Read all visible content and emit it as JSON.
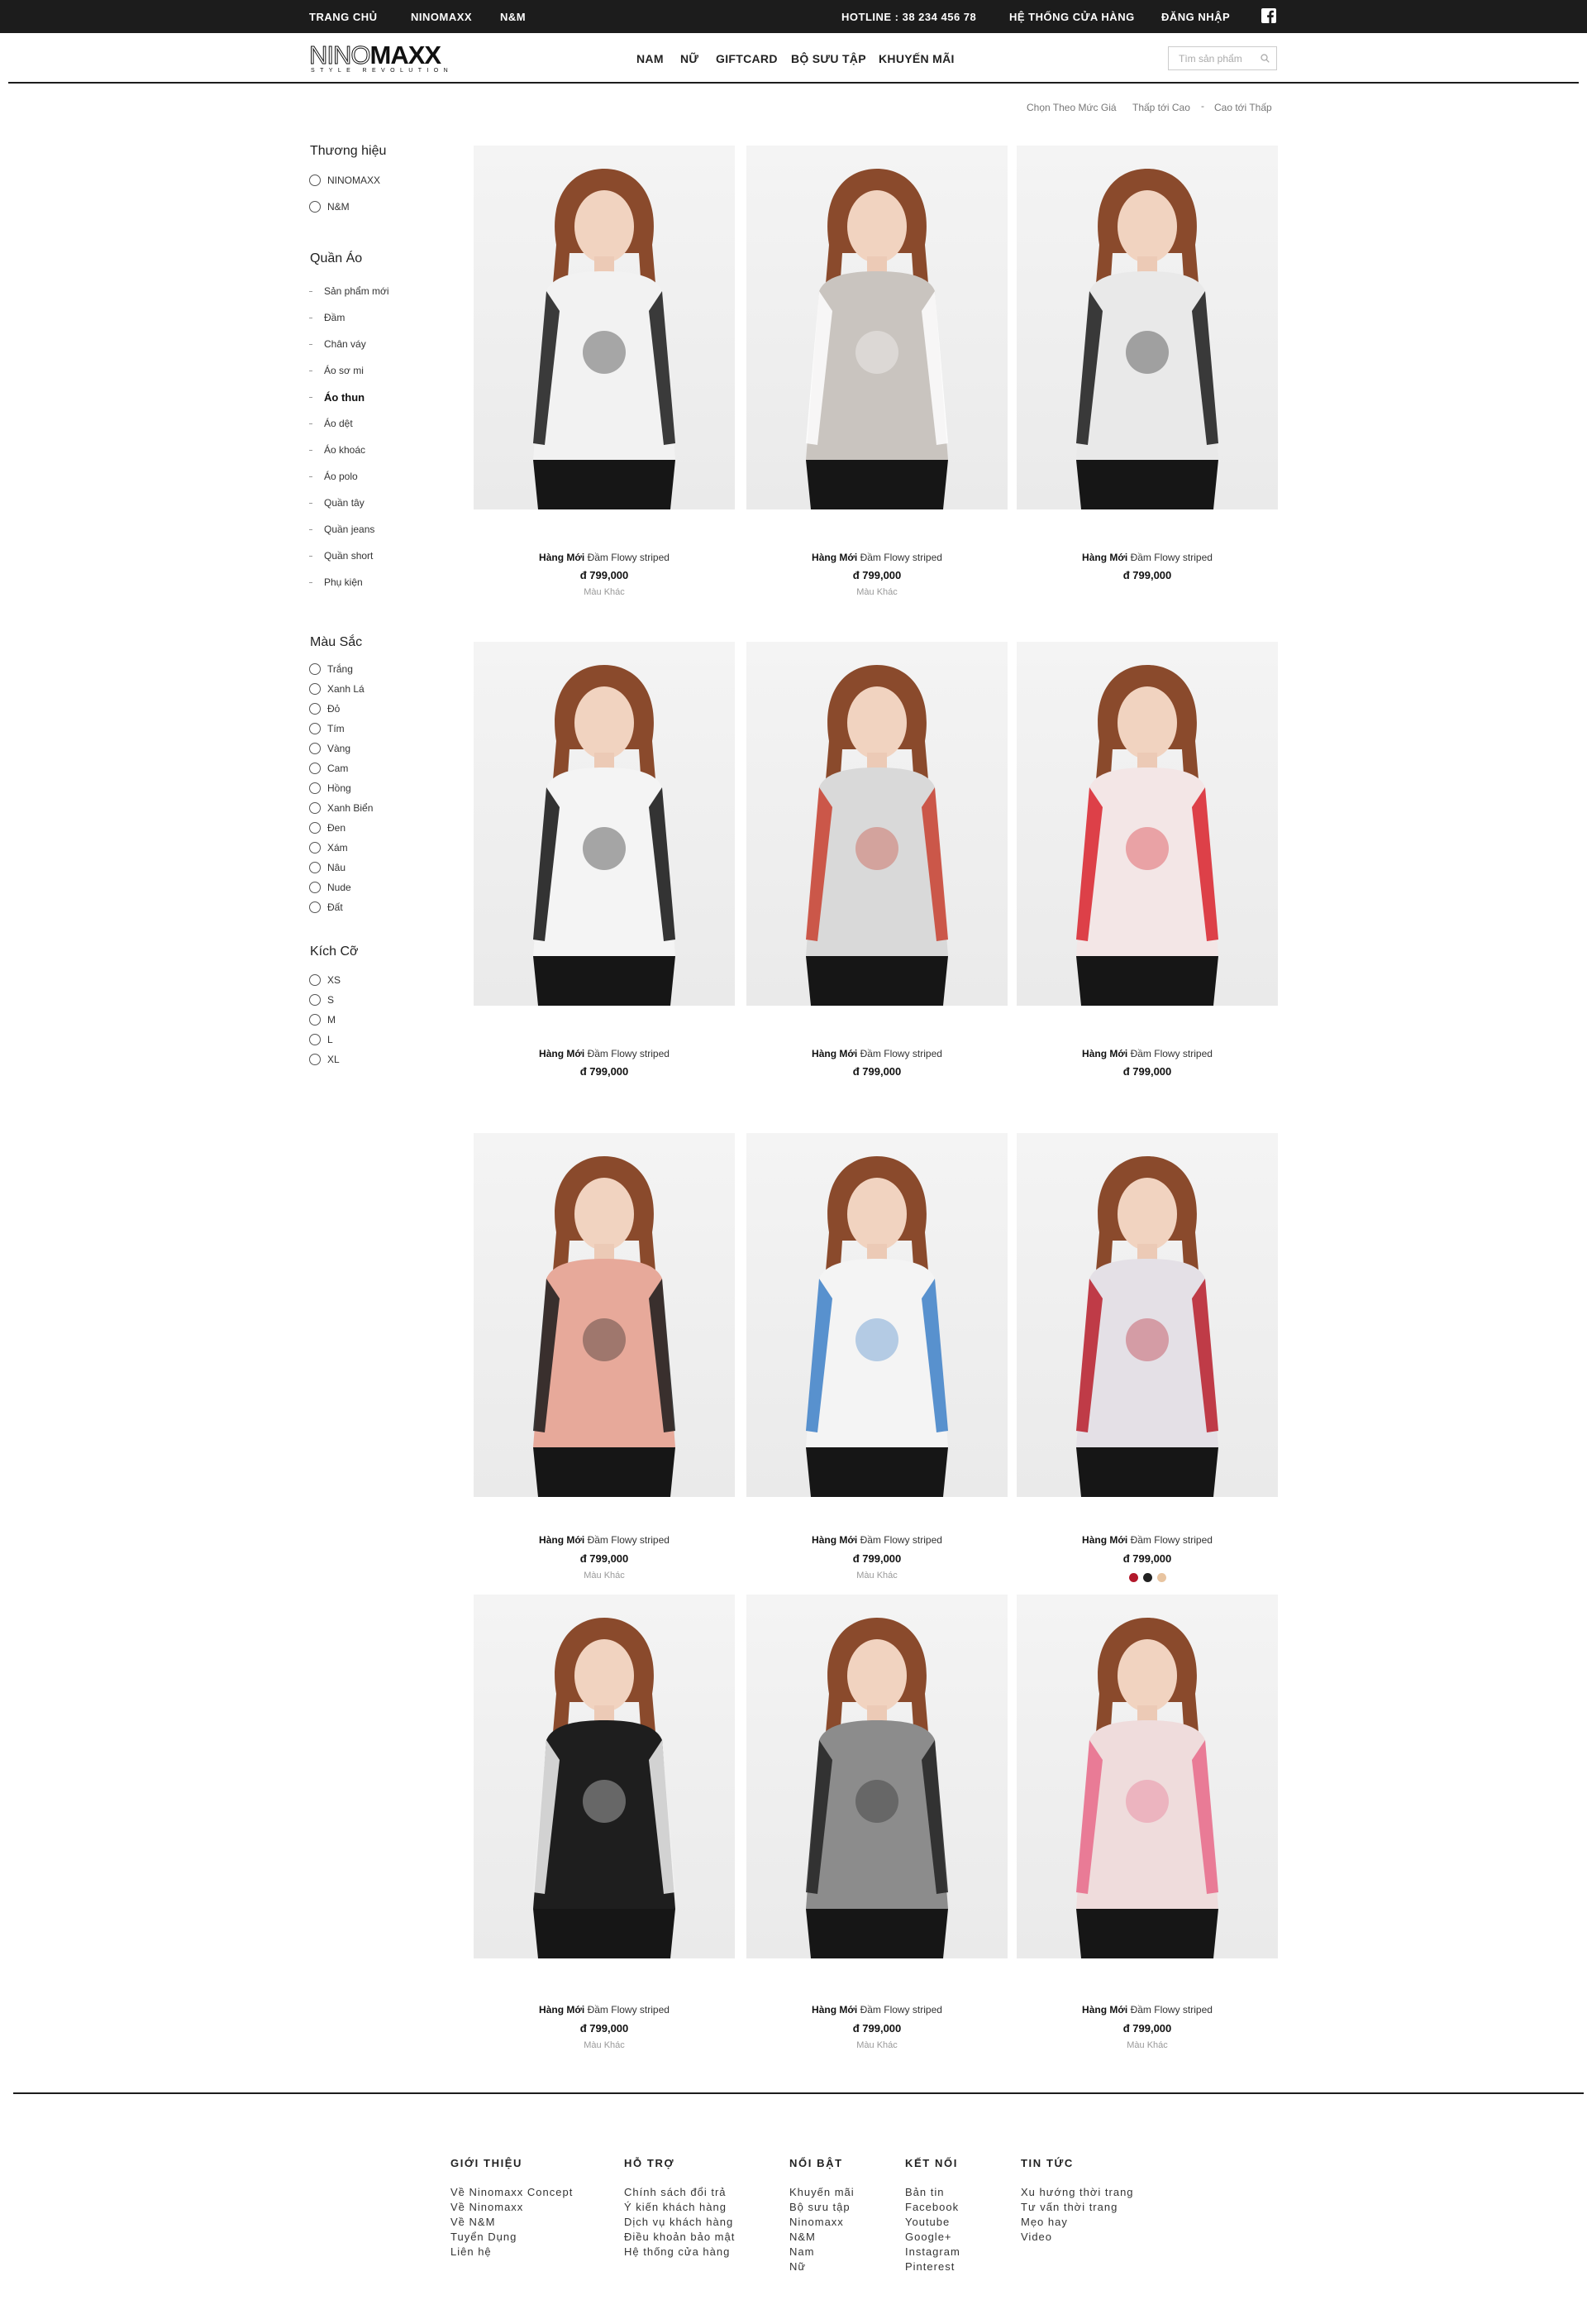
{
  "topbar": {
    "left": [
      "TRANG CHỦ",
      "NINOMAXX",
      "N&M"
    ],
    "hotline": "HOTLINE : 38 234 456 78",
    "stores": "HỆ THỐNG CỬA HÀNG",
    "login": "ĐĂNG NHẬP",
    "social_icon": "facebook-icon"
  },
  "header": {
    "logo_thin": "NINO",
    "logo_bold": "MAXX",
    "logo_tagline": "STYLE REVOLUTION",
    "nav": [
      "NAM",
      "NỮ",
      "GIFTCARD",
      "BỘ SƯU TẬP",
      "KHUYẾN MÃI"
    ],
    "search_placeholder": "Tìm sản phẩm"
  },
  "sort": {
    "label": "Chọn Theo Mức Giá",
    "low_high": "Thấp tới Cao",
    "separator": "-",
    "high_low": "Cao tới Thấp"
  },
  "sidebar": {
    "brand_title": "Thương hiệu",
    "brands": [
      "NINOMAXX",
      "N&M"
    ],
    "cat_title": "Quần Áo",
    "categories": [
      "Sản phẩm mới",
      "Đầm",
      "Chân váy",
      "Áo sơ mi",
      "Áo thun",
      "Áo dệt",
      "Áo khoác",
      "Áo polo",
      "Quần tây",
      "Quần jeans",
      "Quần short",
      "Phụ kiện"
    ],
    "active_category": "Áo thun",
    "color_title": "Màu Sắc",
    "colors": [
      "Trắng",
      "Xanh Lá",
      "Đỏ",
      "Tím",
      "Vàng",
      "Cam",
      "Hồng",
      "Xanh Biển",
      "Đen",
      "Xám",
      "Nâu",
      "Nude",
      "Đất"
    ],
    "size_title": "Kích Cỡ",
    "sizes": [
      "XS",
      "S",
      "M",
      "L",
      "XL"
    ]
  },
  "products": [
    {
      "tag": "Hàng Mới",
      "name": "Đầm Flowy striped",
      "price": "đ 799,000",
      "more": "Màu Khác",
      "top_color": "#f2f2f2",
      "accent": "#1a1a1a"
    },
    {
      "tag": "Hàng Mới",
      "name": "Đầm Flowy striped",
      "price": "đ 799,000",
      "more": "Màu Khác",
      "top_color": "#c9c4bf",
      "accent": "#ffffff"
    },
    {
      "tag": "Hàng Mới",
      "name": "Đầm Flowy striped",
      "price": "đ 799,000",
      "more": "",
      "top_color": "#e9e9e9",
      "accent": "#1a1a1a"
    },
    {
      "tag": "Hàng Mới",
      "name": "Đầm Flowy striped",
      "price": "đ 799,000",
      "more": "",
      "top_color": "#f4f4f4",
      "accent": "#111111"
    },
    {
      "tag": "Hàng Mới",
      "name": "Đầm Flowy striped",
      "price": "đ 799,000",
      "more": "",
      "top_color": "#d9d9d9",
      "accent": "#c8402f"
    },
    {
      "tag": "Hàng Mới",
      "name": "Đầm Flowy striped",
      "price": "đ 799,000",
      "more": "",
      "top_color": "#f3e6e6",
      "accent": "#d8222c"
    },
    {
      "tag": "Hàng Mới",
      "name": "Đầm Flowy striped",
      "price": "đ 799,000",
      "more": "Màu Khác",
      "top_color": "#e7a99a",
      "accent": "#1a1a1a"
    },
    {
      "tag": "Hàng Mới",
      "name": "Đầm Flowy striped",
      "price": "đ 799,000",
      "more": "Màu Khác",
      "top_color": "#f4f4f4",
      "accent": "#3c7fc7"
    },
    {
      "tag": "Hàng Mới",
      "name": "Đầm Flowy striped",
      "price": "đ 799,000",
      "more": "",
      "top_color": "#e4e0e6",
      "accent": "#b81d2a",
      "swatches": [
        "#b2182b",
        "#222222",
        "#e8c4a0"
      ]
    },
    {
      "tag": "Hàng Mới",
      "name": "Đầm Flowy striped",
      "price": "đ 799,000",
      "more": "Màu Khác",
      "top_color": "#1e1e1e",
      "accent": "#f2f2f2"
    },
    {
      "tag": "Hàng Mới",
      "name": "Đầm Flowy striped",
      "price": "đ 799,000",
      "more": "Màu Khác",
      "top_color": "#8c8c8c",
      "accent": "#222222"
    },
    {
      "tag": "Hàng Mới",
      "name": "Đầm Flowy striped",
      "price": "đ 799,000",
      "more": "Màu Khác",
      "top_color": "#efdcdc",
      "accent": "#e86a8a"
    }
  ],
  "footer": {
    "columns": [
      {
        "title": "GIỚI THIỆU",
        "links": [
          "Về Ninomaxx Concept",
          "Về Ninomaxx",
          "Về N&M",
          "Tuyển Dụng",
          "Liên hệ"
        ]
      },
      {
        "title": "HỖ TRỢ",
        "links": [
          "Chính sách đổi trả",
          "Ý kiến khách hàng",
          "Dịch vụ khách hàng",
          "Điều khoản bảo mật",
          "Hệ thống cửa hàng"
        ]
      },
      {
        "title": "NỔI BẬT",
        "links": [
          "Khuyến mãi",
          "Bộ sưu tập",
          "Ninomaxx",
          "N&M",
          "Nam",
          "Nữ"
        ]
      },
      {
        "title": "KẾT NỐI",
        "links": [
          "Bản tin",
          "Facebook",
          "Youtube",
          "Google+",
          "Instagram",
          "Pinterest"
        ]
      },
      {
        "title": "TIN TỨC",
        "links": [
          "Xu hướng thời trang",
          "Tư vấn thời trang",
          "Mẹo hay",
          "Video"
        ]
      }
    ]
  }
}
